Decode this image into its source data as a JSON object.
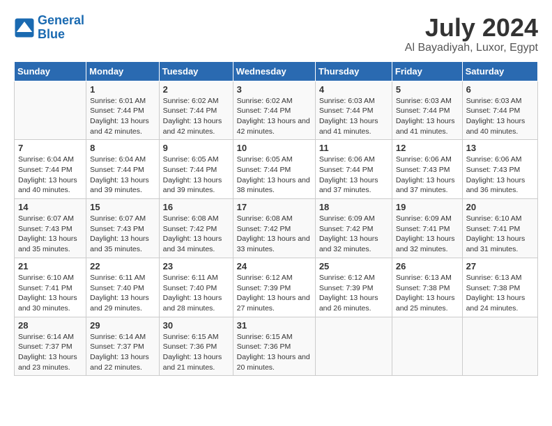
{
  "header": {
    "logo_line1": "General",
    "logo_line2": "Blue",
    "month_year": "July 2024",
    "location": "Al Bayadiyah, Luxor, Egypt"
  },
  "days_of_week": [
    "Sunday",
    "Monday",
    "Tuesday",
    "Wednesday",
    "Thursday",
    "Friday",
    "Saturday"
  ],
  "weeks": [
    [
      {
        "day": "",
        "content": ""
      },
      {
        "day": "1",
        "content": "Sunrise: 6:01 AM\nSunset: 7:44 PM\nDaylight: 13 hours and 42 minutes."
      },
      {
        "day": "2",
        "content": "Sunrise: 6:02 AM\nSunset: 7:44 PM\nDaylight: 13 hours and 42 minutes."
      },
      {
        "day": "3",
        "content": "Sunrise: 6:02 AM\nSunset: 7:44 PM\nDaylight: 13 hours and 42 minutes."
      },
      {
        "day": "4",
        "content": "Sunrise: 6:03 AM\nSunset: 7:44 PM\nDaylight: 13 hours and 41 minutes."
      },
      {
        "day": "5",
        "content": "Sunrise: 6:03 AM\nSunset: 7:44 PM\nDaylight: 13 hours and 41 minutes."
      },
      {
        "day": "6",
        "content": "Sunrise: 6:03 AM\nSunset: 7:44 PM\nDaylight: 13 hours and 40 minutes."
      }
    ],
    [
      {
        "day": "7",
        "content": "Sunrise: 6:04 AM\nSunset: 7:44 PM\nDaylight: 13 hours and 40 minutes."
      },
      {
        "day": "8",
        "content": "Sunrise: 6:04 AM\nSunset: 7:44 PM\nDaylight: 13 hours and 39 minutes."
      },
      {
        "day": "9",
        "content": "Sunrise: 6:05 AM\nSunset: 7:44 PM\nDaylight: 13 hours and 39 minutes."
      },
      {
        "day": "10",
        "content": "Sunrise: 6:05 AM\nSunset: 7:44 PM\nDaylight: 13 hours and 38 minutes."
      },
      {
        "day": "11",
        "content": "Sunrise: 6:06 AM\nSunset: 7:44 PM\nDaylight: 13 hours and 37 minutes."
      },
      {
        "day": "12",
        "content": "Sunrise: 6:06 AM\nSunset: 7:43 PM\nDaylight: 13 hours and 37 minutes."
      },
      {
        "day": "13",
        "content": "Sunrise: 6:06 AM\nSunset: 7:43 PM\nDaylight: 13 hours and 36 minutes."
      }
    ],
    [
      {
        "day": "14",
        "content": "Sunrise: 6:07 AM\nSunset: 7:43 PM\nDaylight: 13 hours and 35 minutes."
      },
      {
        "day": "15",
        "content": "Sunrise: 6:07 AM\nSunset: 7:43 PM\nDaylight: 13 hours and 35 minutes."
      },
      {
        "day": "16",
        "content": "Sunrise: 6:08 AM\nSunset: 7:42 PM\nDaylight: 13 hours and 34 minutes."
      },
      {
        "day": "17",
        "content": "Sunrise: 6:08 AM\nSunset: 7:42 PM\nDaylight: 13 hours and 33 minutes."
      },
      {
        "day": "18",
        "content": "Sunrise: 6:09 AM\nSunset: 7:42 PM\nDaylight: 13 hours and 32 minutes."
      },
      {
        "day": "19",
        "content": "Sunrise: 6:09 AM\nSunset: 7:41 PM\nDaylight: 13 hours and 32 minutes."
      },
      {
        "day": "20",
        "content": "Sunrise: 6:10 AM\nSunset: 7:41 PM\nDaylight: 13 hours and 31 minutes."
      }
    ],
    [
      {
        "day": "21",
        "content": "Sunrise: 6:10 AM\nSunset: 7:41 PM\nDaylight: 13 hours and 30 minutes."
      },
      {
        "day": "22",
        "content": "Sunrise: 6:11 AM\nSunset: 7:40 PM\nDaylight: 13 hours and 29 minutes."
      },
      {
        "day": "23",
        "content": "Sunrise: 6:11 AM\nSunset: 7:40 PM\nDaylight: 13 hours and 28 minutes."
      },
      {
        "day": "24",
        "content": "Sunrise: 6:12 AM\nSunset: 7:39 PM\nDaylight: 13 hours and 27 minutes."
      },
      {
        "day": "25",
        "content": "Sunrise: 6:12 AM\nSunset: 7:39 PM\nDaylight: 13 hours and 26 minutes."
      },
      {
        "day": "26",
        "content": "Sunrise: 6:13 AM\nSunset: 7:38 PM\nDaylight: 13 hours and 25 minutes."
      },
      {
        "day": "27",
        "content": "Sunrise: 6:13 AM\nSunset: 7:38 PM\nDaylight: 13 hours and 24 minutes."
      }
    ],
    [
      {
        "day": "28",
        "content": "Sunrise: 6:14 AM\nSunset: 7:37 PM\nDaylight: 13 hours and 23 minutes."
      },
      {
        "day": "29",
        "content": "Sunrise: 6:14 AM\nSunset: 7:37 PM\nDaylight: 13 hours and 22 minutes."
      },
      {
        "day": "30",
        "content": "Sunrise: 6:15 AM\nSunset: 7:36 PM\nDaylight: 13 hours and 21 minutes."
      },
      {
        "day": "31",
        "content": "Sunrise: 6:15 AM\nSunset: 7:36 PM\nDaylight: 13 hours and 20 minutes."
      },
      {
        "day": "",
        "content": ""
      },
      {
        "day": "",
        "content": ""
      },
      {
        "day": "",
        "content": ""
      }
    ]
  ]
}
